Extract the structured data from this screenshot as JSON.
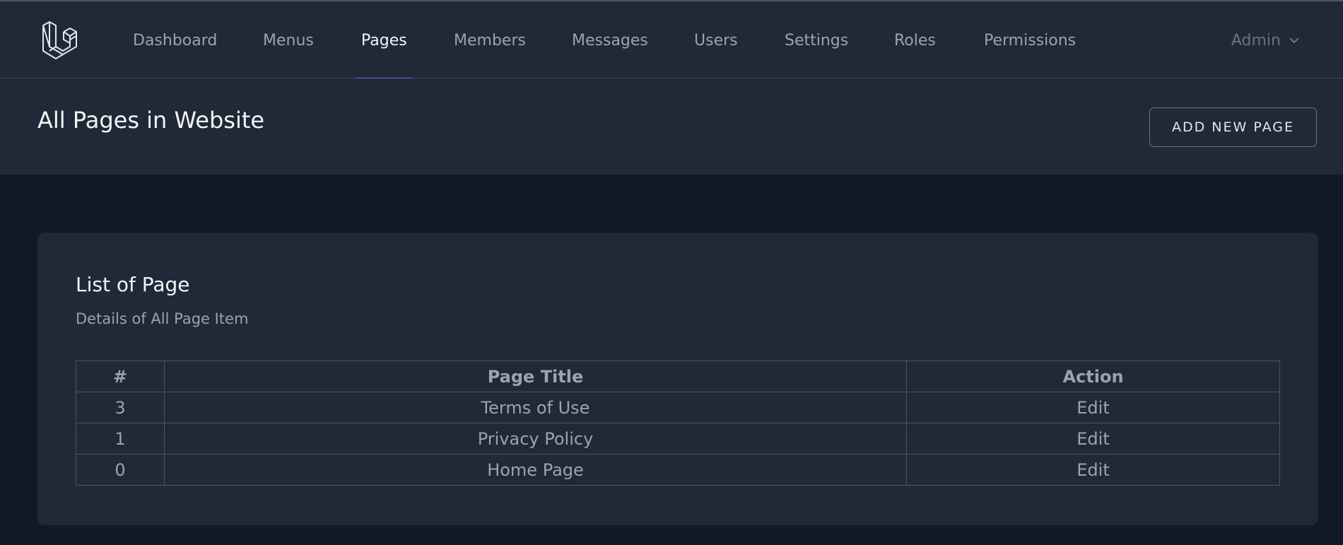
{
  "nav": {
    "items": [
      {
        "label": "Dashboard"
      },
      {
        "label": "Menus"
      },
      {
        "label": "Pages"
      },
      {
        "label": "Members"
      },
      {
        "label": "Messages"
      },
      {
        "label": "Users"
      },
      {
        "label": "Settings"
      },
      {
        "label": "Roles"
      },
      {
        "label": "Permissions"
      }
    ],
    "active": "Pages",
    "user": "Admin",
    "logo_icon": "laravel-logo-icon",
    "accent_color": "#6366f1"
  },
  "header": {
    "title": "All Pages in Website",
    "add_button": "ADD NEW PAGE"
  },
  "card": {
    "title": "List of Page",
    "subtitle": "Details of All Page Item",
    "table": {
      "headers": [
        "#",
        "Page Title",
        "Action"
      ],
      "rows": [
        {
          "id": "3",
          "title": "Terms of Use",
          "action": "Edit"
        },
        {
          "id": "1",
          "title": "Privacy Policy",
          "action": "Edit"
        },
        {
          "id": "0",
          "title": "Home Page",
          "action": "Edit"
        }
      ]
    }
  }
}
